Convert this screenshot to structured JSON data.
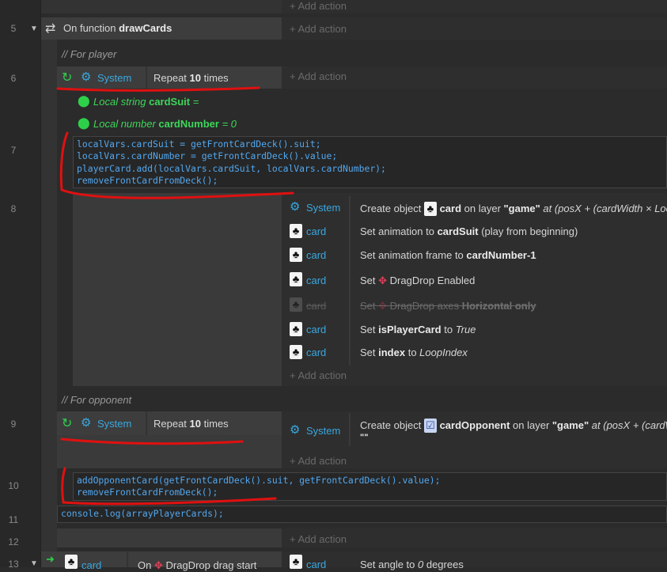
{
  "lines": {
    "l5": "5",
    "l6": "6",
    "l7": "7",
    "l8": "8",
    "l9": "9",
    "l10": "10",
    "l11": "11",
    "l12": "12",
    "l13": "13"
  },
  "top_add_action": "Add action",
  "event5": {
    "prefix": "On function ",
    "name": "drawCards",
    "add_action": "Add action"
  },
  "comment_player": "// For player",
  "event6": {
    "system": "System",
    "repeat_prefix": "Repeat ",
    "repeat_count": "10",
    "repeat_suffix": " times",
    "add_action": "Add action"
  },
  "local1": {
    "prefix": "Local string ",
    "name": "cardSuit",
    "suffix": " ="
  },
  "local2": {
    "prefix": "Local number ",
    "name": "cardNumber",
    "suffix": " = 0"
  },
  "code7": {
    "l1a": "localVars.",
    "l1b": "cardSuit",
    " l1c": "",
    "line1": "localVars.cardSuit = getFrontCardDeck().suit;",
    "line2": "localVars.cardNumber = getFrontCardDeck().value;",
    "line3": "playerCard.add(localVars.cardSuit, localVars.cardNumber);",
    "line4": "removeFrontCardFromDeck();"
  },
  "actions8": [
    {
      "object": "System",
      "parts": [
        "Create object ",
        "card",
        " on layer ",
        "\"game\"",
        " at (posX + (cardWidth × Loc"
      ]
    },
    {
      "object": "card",
      "parts": [
        "Set animation to ",
        "cardSuit",
        " (play from beginning)"
      ]
    },
    {
      "object": "card",
      "parts": [
        "Set animation frame to ",
        "cardNumber-1"
      ]
    },
    {
      "object": "card",
      "parts": [
        "Set ",
        "DragDrop Enabled"
      ]
    },
    {
      "object": "card",
      "parts": [
        "Set ",
        "DragDrop axes ",
        "Horizontal only"
      ]
    },
    {
      "object": "card",
      "parts": [
        "Set ",
        "isPlayerCard",
        " to ",
        "True"
      ]
    },
    {
      "object": "card",
      "parts": [
        "Set ",
        "index",
        " to ",
        "LoopIndex"
      ]
    }
  ],
  "add_action8": "Add action",
  "comment_opponent": "// For opponent",
  "event9": {
    "system": "System",
    "repeat_prefix": "Repeat ",
    "repeat_count": "10",
    "repeat_suffix": " times",
    "action_object": "System",
    "action_parts": [
      "Create object ",
      "cardOpponent",
      " on layer ",
      "\"game\"",
      " at (posX + (cardW"
    ],
    "action_extra": "\"\"",
    "add_action": "Add action"
  },
  "code10": {
    "line1": "addOpponentCard(getFrontCardDeck().suit, getFrontCardDeck().value);",
    "line2": "removeFrontCardFromDeck();"
  },
  "code11": {
    "line1": "console.log(arrayPlayerCards);"
  },
  "add_action12": "Add action",
  "event13": {
    "condition_object": "card",
    "condition_text": "On ",
    "condition_behavior": "DragDrop drag start",
    "action_object": "card",
    "action_prefix": "Set angle to ",
    "action_value": "0",
    "action_suffix": " degrees"
  }
}
